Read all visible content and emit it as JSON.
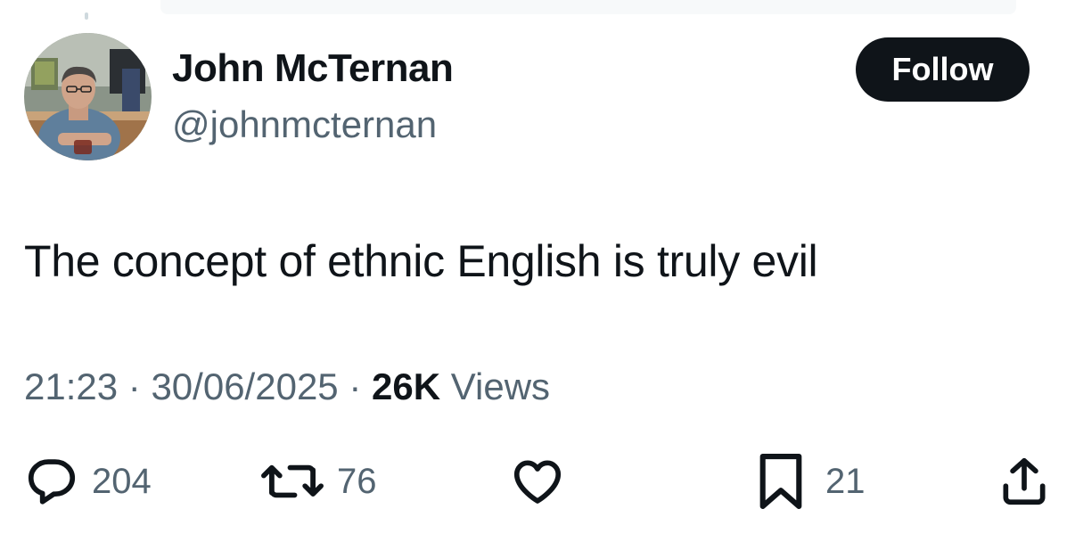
{
  "author": {
    "name": "John McTernan",
    "handle": "@johnmcternan",
    "avatar_icon": "profile-photo"
  },
  "follow_button": {
    "label": "Follow"
  },
  "tweet": {
    "text": "The concept of ethnic English is truly evil"
  },
  "meta": {
    "time": "21:23",
    "separator": "·",
    "date": "30/06/2025",
    "views_count": "26K",
    "views_label": "Views"
  },
  "actions": {
    "reply": {
      "icon": "reply-icon",
      "count": "204"
    },
    "retweet": {
      "icon": "retweet-icon",
      "count": "76"
    },
    "like": {
      "icon": "heart-icon",
      "count": ""
    },
    "bookmark": {
      "icon": "bookmark-icon",
      "count": "21"
    },
    "share": {
      "icon": "share-icon"
    }
  },
  "colors": {
    "text_primary": "#0f1419",
    "text_secondary": "#536471",
    "button_bg": "#0f1419",
    "background": "#ffffff"
  }
}
